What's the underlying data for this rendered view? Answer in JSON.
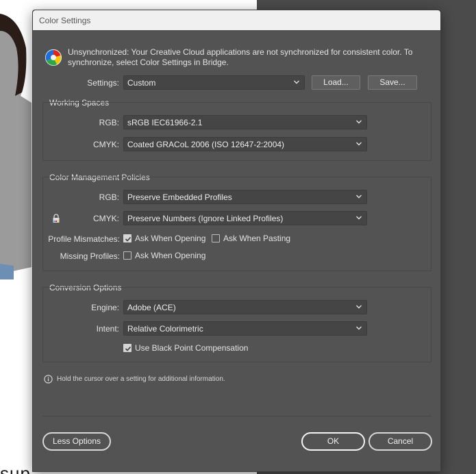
{
  "window": {
    "title": "Color Settings"
  },
  "background": {
    "bottom_text": "sup"
  },
  "sync_message": "Unsynchronized: Your Creative Cloud applications are not synchronized for consistent color. To synchronize, select Color Settings in Bridge.",
  "settings": {
    "label": "Settings:",
    "value": "Custom",
    "load_label": "Load...",
    "save_label": "Save..."
  },
  "working_spaces": {
    "title": "Working Spaces",
    "rgb_label": "RGB:",
    "rgb_value": "sRGB IEC61966-2.1",
    "cmyk_label": "CMYK:",
    "cmyk_value": "Coated GRACoL 2006 (ISO 12647-2:2004)"
  },
  "policies": {
    "title": "Color Management Policies",
    "rgb_label": "RGB:",
    "rgb_value": "Preserve Embedded Profiles",
    "cmyk_label": "CMYK:",
    "cmyk_value": "Preserve Numbers (Ignore Linked Profiles)",
    "mismatch_label": "Profile Mismatches:",
    "ask_opening_label": "Ask When Opening",
    "ask_opening_checked": true,
    "ask_pasting_label": "Ask When Pasting",
    "ask_pasting_checked": false,
    "missing_label": "Missing Profiles:",
    "missing_opening_label": "Ask When Opening",
    "missing_opening_checked": false
  },
  "conversion": {
    "title": "Conversion Options",
    "engine_label": "Engine:",
    "engine_value": "Adobe (ACE)",
    "intent_label": "Intent:",
    "intent_value": "Relative Colorimetric",
    "bpc_label": "Use Black Point Compensation",
    "bpc_checked": true
  },
  "info_text": "Hold the cursor over a setting for additional information.",
  "footer": {
    "less_options_label": "Less Options",
    "ok_label": "OK",
    "cancel_label": "Cancel"
  },
  "colors": {
    "dialog_bg": "#535353",
    "titlebar_bg": "#f0f0f0",
    "field_bg": "#454545",
    "text": "#e3e3e3"
  }
}
